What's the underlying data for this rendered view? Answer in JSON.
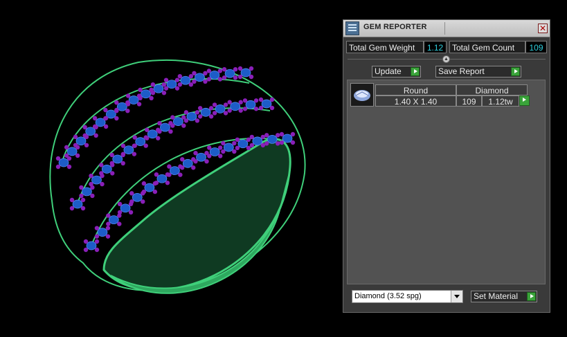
{
  "viewport": {
    "colors": {
      "metal": "#3fcf7a",
      "stone": "#1d5cc8",
      "prong": "#8a1fb8",
      "background": "#000000"
    }
  },
  "panel": {
    "title": "GEM REPORTER",
    "close_icon": "close-icon",
    "app_icon": "gem-reporter-icon",
    "total_weight_label": "Total Gem Weight",
    "total_weight_value": "1.12",
    "total_count_label": "Total Gem Count",
    "total_count_value": "109",
    "update_label": "Update",
    "save_report_label": "Save Report",
    "report": {
      "columns": [
        "Round",
        "Diamond"
      ],
      "rows": [
        {
          "thumbnail": "round-diamond-icon",
          "size": "1.40 X 1.40",
          "count": "109",
          "weight": "1.12tw"
        }
      ]
    },
    "material_selected": "Diamond      (3.52 spg)",
    "set_material_label": "Set Material"
  }
}
